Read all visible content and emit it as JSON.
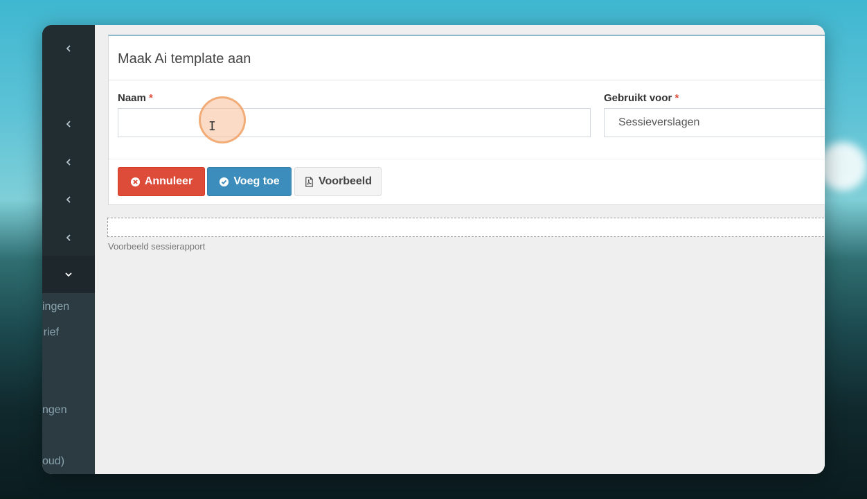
{
  "sidebar": {
    "items": [
      {
        "icon": "chevron-left-icon"
      },
      {
        "icon": "chevron-left-icon"
      },
      {
        "icon": "chevron-left-icon"
      },
      {
        "icon": "chevron-left-icon"
      },
      {
        "icon": "chevron-left-icon"
      },
      {
        "icon": "chevron-down-icon"
      }
    ],
    "subitems": [
      "ingen",
      "rief",
      "ngen",
      "oud)"
    ]
  },
  "form": {
    "title": "Maak Ai template aan",
    "name_label": "Naam",
    "name_value": "",
    "used_for_label": "Gebruikt voor",
    "used_for_value": "Sessieverslagen",
    "required_marker": "*"
  },
  "buttons": {
    "cancel": "Annuleer",
    "add": "Voeg toe",
    "preview": "Voorbeeld"
  },
  "preview": {
    "caption": "Voorbeeld sessierapport"
  },
  "colors": {
    "danger": "#dd4b39",
    "primary": "#3c8dbc",
    "sidebar": "#222d32"
  }
}
